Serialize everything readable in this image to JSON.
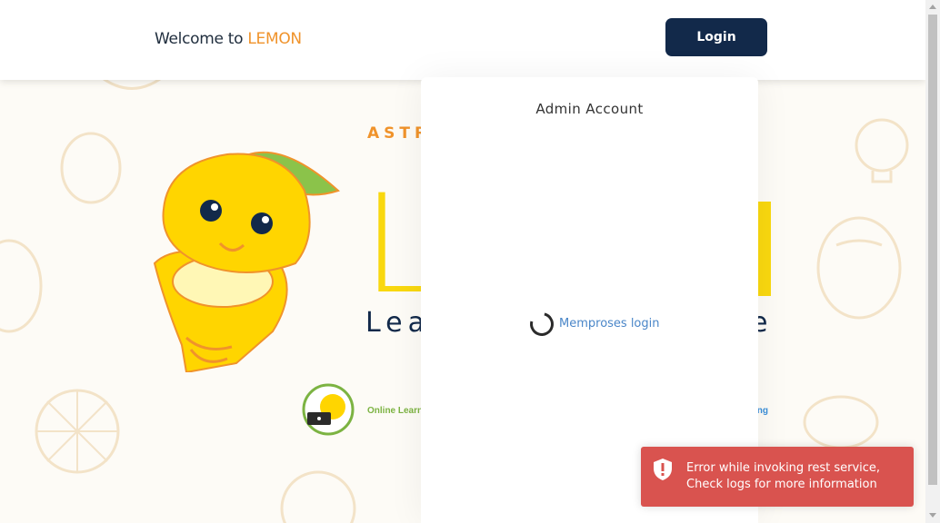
{
  "header": {
    "welcome_prefix": "Welcome to ",
    "brand": "LEMON",
    "login_label": "Login"
  },
  "hero": {
    "astra": "ASTRA",
    "title_fragment": "L",
    "tagline_start": "Lea",
    "tagline_end": "e",
    "online_text": "Online Learn",
    "right_text": "ing"
  },
  "modal": {
    "title": "Admin Account",
    "status": "Memproses login",
    "spinner_icon": "loading-spinner-icon"
  },
  "toast": {
    "icon": "shield-alert-icon",
    "message": "Error while invoking rest service, Check logs for more information",
    "color": "#d9534f"
  },
  "colors": {
    "brand_orange": "#f0932b",
    "navy": "#12294a",
    "lemon_yellow": "#f9d80f"
  }
}
